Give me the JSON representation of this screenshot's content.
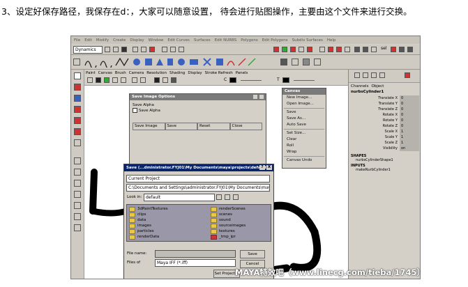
{
  "caption": "3、设定好保存路径，我保存在d：，大家可以随意设置， 待会进行贴图操作，主要由这个文件来进行交换。",
  "maya": {
    "menubar": [
      "File",
      "Edit",
      "Modify",
      "Create",
      "Display",
      "Window",
      "Edit Curves",
      "Surfaces",
      "Edit NURBS",
      "Polygons",
      "Edit Polygons",
      "Subdiv Surfaces",
      "Help"
    ],
    "mode_dropdown": "Dynamics",
    "panel_menu": [
      "Paint",
      "Canvas",
      "Brush",
      "Camera",
      "Resolution",
      "Shading",
      "Display",
      "Stroke Refresh",
      "Panels"
    ],
    "toolbar_c_label": "C",
    "toolbar_t_label": "T",
    "sel_label": "sel"
  },
  "save_image_options": {
    "title": "Save Image Options",
    "section": "Save Alpha",
    "checkbox_label": "Save Alpha",
    "buttons": [
      "Save Image",
      "Save",
      "Reset",
      "Close"
    ]
  },
  "canvas_menu": {
    "title": "Canvas",
    "items": [
      "New Image...",
      "Open Image...",
      "Save",
      "Save As...",
      "Auto Save",
      "Set Size...",
      "Clear",
      "Roll",
      "Wrap",
      "Canvas Undo"
    ]
  },
  "channel_box": {
    "tabs": [
      "Channels",
      "Object"
    ],
    "object_name": "nurbsCylinder1",
    "attributes": [
      {
        "name": "Translate X",
        "value": "0"
      },
      {
        "name": "Translate Y",
        "value": "0"
      },
      {
        "name": "Translate Z",
        "value": "0"
      },
      {
        "name": "Rotate X",
        "value": "0"
      },
      {
        "name": "Rotate Y",
        "value": "0"
      },
      {
        "name": "Rotate Z",
        "value": "0"
      },
      {
        "name": "Scale X",
        "value": "1"
      },
      {
        "name": "Scale Y",
        "value": "1"
      },
      {
        "name": "Scale Z",
        "value": "1"
      },
      {
        "name": "Visibility",
        "value": "on"
      }
    ],
    "shapes_header": "SHAPES",
    "shape_name": "nurbsCylinderShape1",
    "inputs_header": "INPUTS",
    "input_name": "makeNurbCylinder1"
  },
  "save_dialog": {
    "title": "Save (...dministrator.FYJ01\\My Documents\\maya\\projects\\default)",
    "title_buttons": [
      "?",
      "X"
    ],
    "project": "Current Project",
    "path": "C:\\Documents and Settings\\administrator.FYJ01\\My Documents\\maya\\projects\\def",
    "look_in_label": "Look in:",
    "look_in_value": "default",
    "folders_left": [
      "3dPaintTextures",
      "clips",
      "data",
      "images",
      "particles",
      "renderData"
    ],
    "folders_right": [
      "renderScenes",
      "scenes",
      "sound",
      "sourceimages",
      "textures",
      "_tmp_ipr"
    ],
    "file_name_label": "File name:",
    "file_name_value": "",
    "files_of_label": "Files of",
    "files_of_value": "Maya IFF (*.iff)",
    "save_button": "Save",
    "cancel_button": "Cancel",
    "set_project_button": "Set Project..."
  },
  "watermark": "MAYA特效吧（www.linecg.com/tieba/1745）"
}
